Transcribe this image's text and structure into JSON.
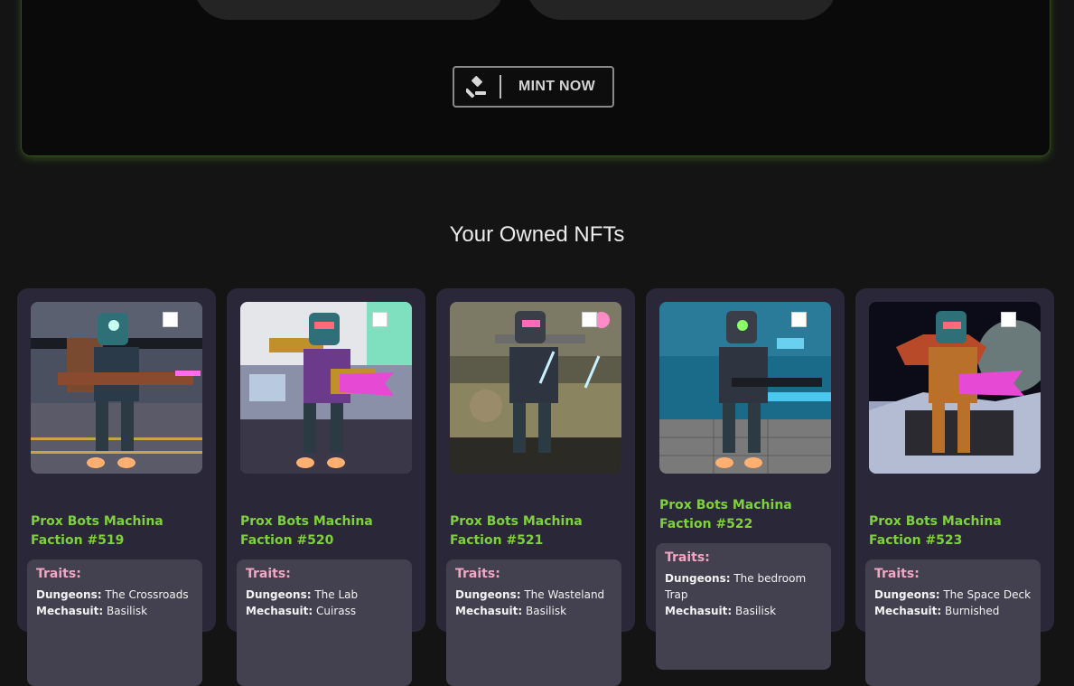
{
  "mint": {
    "button_label": "MINT NOW",
    "icon": "gavel-icon"
  },
  "section_title": "Your Owned NFTs",
  "nfts": [
    {
      "name": "Prox Bots Machina Faction #519",
      "traits_label": "Traits:",
      "traits": [
        {
          "key": "Dungeons:",
          "value": "The Crossroads"
        },
        {
          "key": "Mechasuit:",
          "value": "Basilisk"
        }
      ]
    },
    {
      "name": "Prox Bots Machina Faction #520",
      "traits_label": "Traits:",
      "traits": [
        {
          "key": "Dungeons:",
          "value": "The Lab"
        },
        {
          "key": "Mechasuit:",
          "value": "Cuirass"
        }
      ]
    },
    {
      "name": "Prox Bots Machina Faction #521",
      "traits_label": "Traits:",
      "traits": [
        {
          "key": "Dungeons:",
          "value": "The Wasteland"
        },
        {
          "key": "Mechasuit:",
          "value": "Basilisk"
        }
      ]
    },
    {
      "name": "Prox Bots Machina Faction #522",
      "traits_label": "Traits:",
      "traits": [
        {
          "key": "Dungeons:",
          "value": "The bedroom Trap"
        },
        {
          "key": "Mechasuit:",
          "value": "Basilisk"
        }
      ]
    },
    {
      "name": "Prox Bots Machina Faction #523",
      "traits_label": "Traits:",
      "traits": [
        {
          "key": "Dungeons:",
          "value": "The Space Deck"
        },
        {
          "key": "Mechasuit:",
          "value": "Burnished"
        }
      ]
    }
  ],
  "colors": {
    "accent_green": "#7fd13b",
    "traits_pink": "#f2a6c2",
    "card_bg": "#2a2838"
  }
}
